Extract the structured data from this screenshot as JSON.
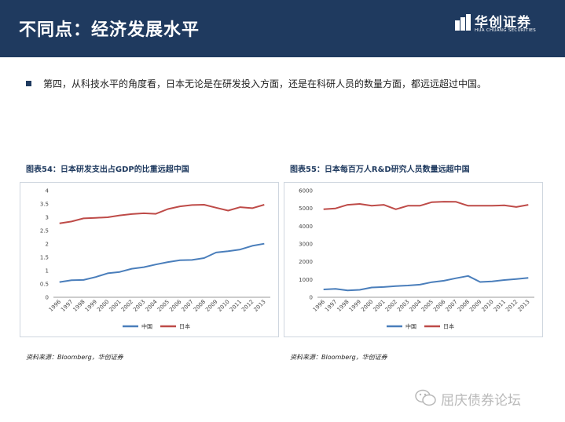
{
  "header": {
    "title": "不同点：经济发展水平"
  },
  "logo": {
    "name_cn": "华创证券",
    "name_en": "HUA CHUANG SECURITIES"
  },
  "bullet": {
    "text": "第四，从科技水平的角度看，日本无论是在研发投入方面，还是在科研人员的数量方面，都远远超过中国。"
  },
  "charts": [
    {
      "title": "图表54：日本研发支出占GDP的比重远超中国",
      "source": "资料来源：Bloomberg，华创证券"
    },
    {
      "title": "图表55：日本每百万人R&D研究人员数量远超中国",
      "source": "资料来源：Bloomberg，华创证券"
    }
  ],
  "watermark": {
    "text": "屈庆债券论坛"
  },
  "colors": {
    "china": "#4a7ebb",
    "japan": "#be4b48",
    "header_bg": "#1f3a5f"
  },
  "chart_data": [
    {
      "type": "line",
      "title": "图表54：日本研发支出占GDP的比重远超中国",
      "x": [
        "1996",
        "1997",
        "1998",
        "1999",
        "2000",
        "2001",
        "2002",
        "2003",
        "2004",
        "2005",
        "2006",
        "2007",
        "2008",
        "2009",
        "2010",
        "2011",
        "2012",
        "2013"
      ],
      "ylim": [
        0,
        4
      ],
      "yticks": [
        "0",
        "0.5",
        "1",
        "1.5",
        "2",
        "2.5",
        "3",
        "3.5",
        "4"
      ],
      "grid": false,
      "legend": "bottom",
      "series": [
        {
          "name": "中国",
          "color": "#4a7ebb",
          "values": [
            0.57,
            0.64,
            0.65,
            0.76,
            0.9,
            0.95,
            1.07,
            1.13,
            1.23,
            1.32,
            1.39,
            1.4,
            1.47,
            1.68,
            1.73,
            1.79,
            1.93,
            2.01
          ]
        },
        {
          "name": "日本",
          "color": "#be4b48",
          "values": [
            2.77,
            2.84,
            2.96,
            2.98,
            3.0,
            3.07,
            3.12,
            3.15,
            3.13,
            3.31,
            3.41,
            3.46,
            3.47,
            3.36,
            3.25,
            3.38,
            3.34,
            3.47
          ]
        }
      ]
    },
    {
      "type": "line",
      "title": "图表55：日本每百万人R&D研究人员数量远超中国",
      "x": [
        "1996",
        "1997",
        "1998",
        "1999",
        "2000",
        "2001",
        "2002",
        "2003",
        "2004",
        "2005",
        "2006",
        "2007",
        "2008",
        "2009",
        "2010",
        "2011",
        "2012",
        "2013"
      ],
      "ylim": [
        0,
        6000
      ],
      "yticks": [
        "0",
        "1000",
        "2000",
        "3000",
        "4000",
        "5000",
        "6000"
      ],
      "grid": false,
      "legend": "bottom",
      "series": [
        {
          "name": "中国",
          "color": "#4a7ebb",
          "values": [
            440,
            470,
            390,
            420,
            550,
            580,
            630,
            660,
            710,
            850,
            930,
            1070,
            1200,
            860,
            890,
            970,
            1030,
            1090
          ]
        },
        {
          "name": "日本",
          "color": "#be4b48",
          "values": [
            4950,
            5000,
            5200,
            5250,
            5150,
            5200,
            4950,
            5150,
            5150,
            5350,
            5380,
            5370,
            5150,
            5150,
            5150,
            5170,
            5080,
            5200
          ]
        }
      ]
    }
  ]
}
